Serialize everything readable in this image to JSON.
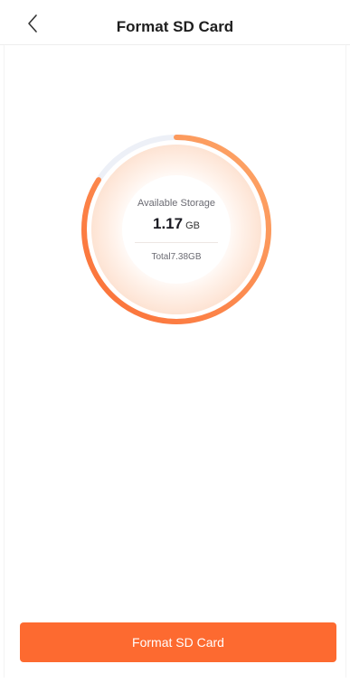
{
  "header": {
    "title": "Format SD Card",
    "back_icon": "chevron-left-icon"
  },
  "storage": {
    "label": "Available Storage",
    "available_value": "1.17",
    "available_unit": "GB",
    "total_text": "Total7.38GB",
    "used_fraction": 0.84
  },
  "actions": {
    "format_label": "Format SD Card"
  },
  "colors": {
    "accent": "#fd6a30",
    "ring_start": "#fb6e35",
    "ring_end": "#fda86a",
    "ring_track": "#edf0f7"
  }
}
